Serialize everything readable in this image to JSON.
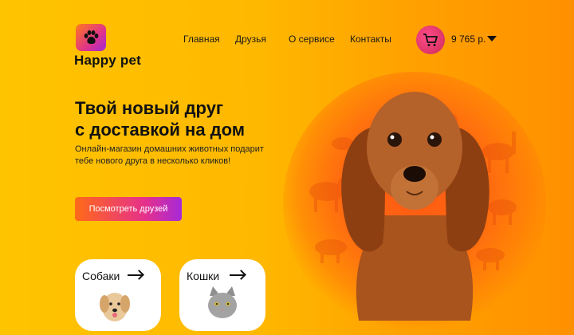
{
  "brand": {
    "name": "Happy pet",
    "logo_icon": "paw-icon",
    "logo_gradient": [
      "#ff7a1a",
      "#e0338a",
      "#a129d8"
    ]
  },
  "nav": {
    "items": [
      {
        "label": "Главная"
      },
      {
        "label": "Друзья"
      },
      {
        "label": "О сервисе"
      },
      {
        "label": "Контакты"
      }
    ]
  },
  "cart": {
    "icon": "cart-icon",
    "balance": "9 765 р.",
    "dropdown_icon": "caret-down-icon",
    "color": "#e43a6e"
  },
  "hero": {
    "title_line1": "Твой новый друг",
    "title_line2": "с доставкой на дом",
    "subtitle": "Онлайн-магазин домашних животных подарит тебе нового друга в несколько кликов!",
    "cta_label": "Посмотреть друзей"
  },
  "categories": [
    {
      "label": "Собаки",
      "icon": "arrow-right-icon"
    },
    {
      "label": "Кошки",
      "icon": "arrow-right-icon"
    }
  ],
  "colors": {
    "background": "#ffb800",
    "accent_orange": "#ff6a18",
    "accent_purple": "#a629d8",
    "glow": "#ff5a12"
  }
}
